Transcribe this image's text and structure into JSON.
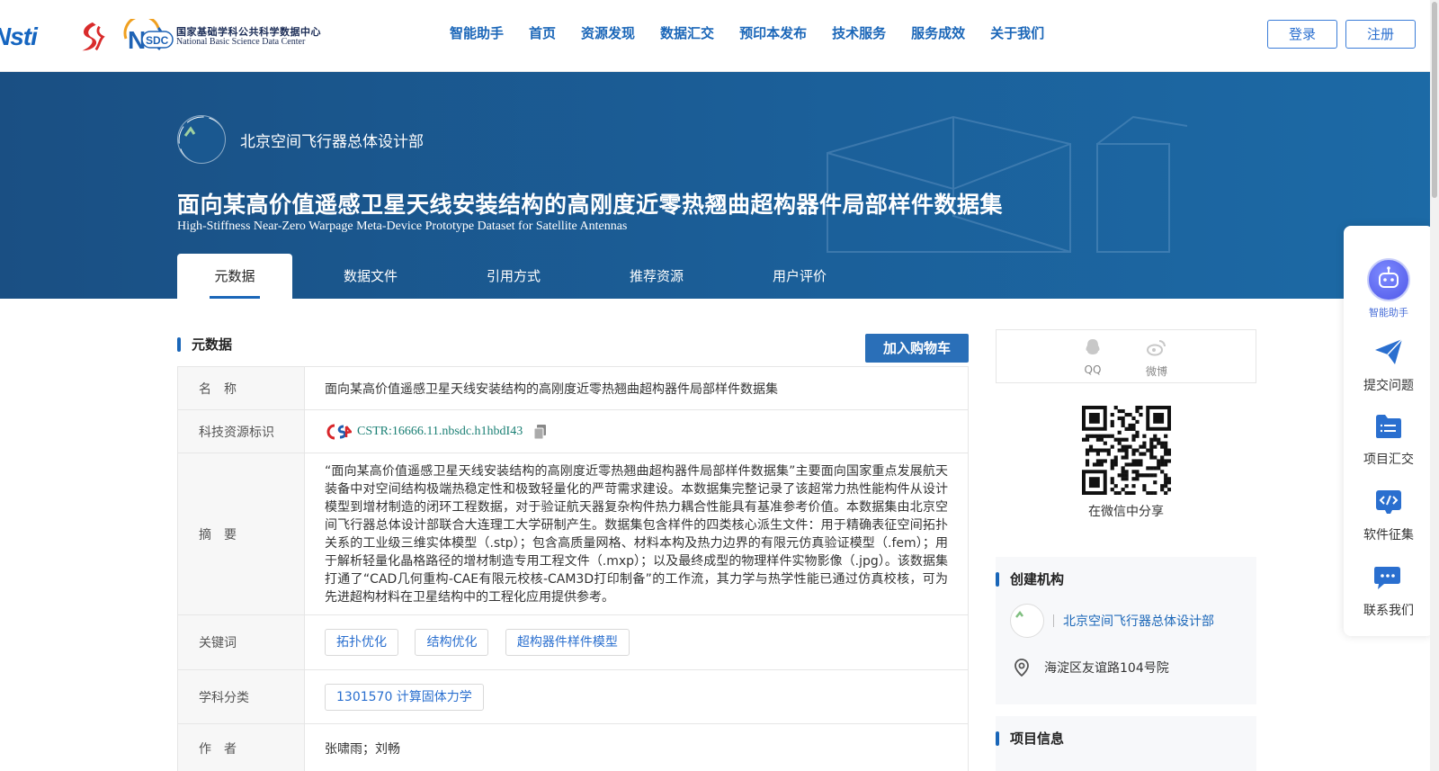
{
  "header": {
    "nsdc_logo_cn": "国家基础学科公共科学数据中心",
    "nsdc_logo_en": "National Basic Science Data Center",
    "nav": [
      "智能助手",
      "首页",
      "资源发现",
      "数据汇交",
      "预印本发布",
      "技术服务",
      "服务成效",
      "关于我们"
    ],
    "login": "登录",
    "register": "注册"
  },
  "banner": {
    "org_name": "北京空间飞行器总体设计部",
    "title": "面向某高价值遥感卫星天线安装结构的高刚度近零热翘曲超构器件局部样件数据集",
    "subtitle": "High-Stiffness Near-Zero Warpage Meta-Device Prototype Dataset for Satellite Antennas",
    "tabs": [
      "元数据",
      "数据文件",
      "引用方式",
      "推荐资源",
      "用户评价"
    ],
    "active_tab": "元数据"
  },
  "metadata": {
    "section_title": "元数据",
    "cart_button": "加入购物车",
    "rows": {
      "name": {
        "key": "名　称",
        "value": "面向某高价值遥感卫星天线安装结构的高刚度近零热翘曲超构器件局部样件数据集"
      },
      "identifier": {
        "key": "科技资源标识",
        "value": "CSTR:16666.11.nbsdc.h1hbdI43"
      },
      "abstract": {
        "key": "摘　要",
        "value": "“面向某高价值遥感卫星天线安装结构的高刚度近零热翘曲超构器件局部样件数据集”主要面向国家重点发展航天装备中对空间结构极端热稳定性和极致轻量化的严苛需求建设。本数据集完整记录了该超常力热性能构件从设计模型到增材制造的闭环工程数据，对于验证航天器复杂构件热力耦合性能具有基准参考价值。本数据集由北京空间飞行器总体设计部联合大连理工大学研制产生。数据集包含样件的四类核心派生文件：用于精确表征空间拓扑关系的工业级三维实体模型（.stp）；包含高质量网格、材料本构及热力边界的有限元仿真验证模型（.fem）；用于解析轻量化晶格路径的增材制造专用工程文件（.mxp）；以及最终成型的物理样件实物影像（.jpg）。该数据集打通了“CAD几何重构-CAE有限元校核-CAM3D打印制备”的工作流，其力学与热学性能已通过仿真校核，可为先进超构材料在卫星结构中的工程化应用提供参考。"
      },
      "keywords": {
        "key": "关键词",
        "values": [
          "拓扑优化",
          "结构优化",
          "超构器件样件模型"
        ]
      },
      "subject": {
        "key": "学科分类",
        "values": [
          "1301570 计算固体力学"
        ]
      },
      "authors": {
        "key": "作　者",
        "value": "张啸雨；刘畅"
      }
    }
  },
  "share": {
    "qq": "QQ",
    "weibo": "微博",
    "wechat": "在微信中分享"
  },
  "institution": {
    "title": "创建机构",
    "name": "北京空间飞行器总体设计部",
    "address": "海淀区友谊路104号院"
  },
  "project": {
    "title": "项目信息"
  },
  "float_menu": [
    "智能助手",
    "提交问题",
    "项目汇交",
    "软件征集",
    "联系我们"
  ],
  "colors": {
    "brand_blue": "#1a66b8",
    "banner_bg": "#1b5f99",
    "cart_button": "#2a6fb8",
    "cstr_id": "#1a7f74"
  }
}
